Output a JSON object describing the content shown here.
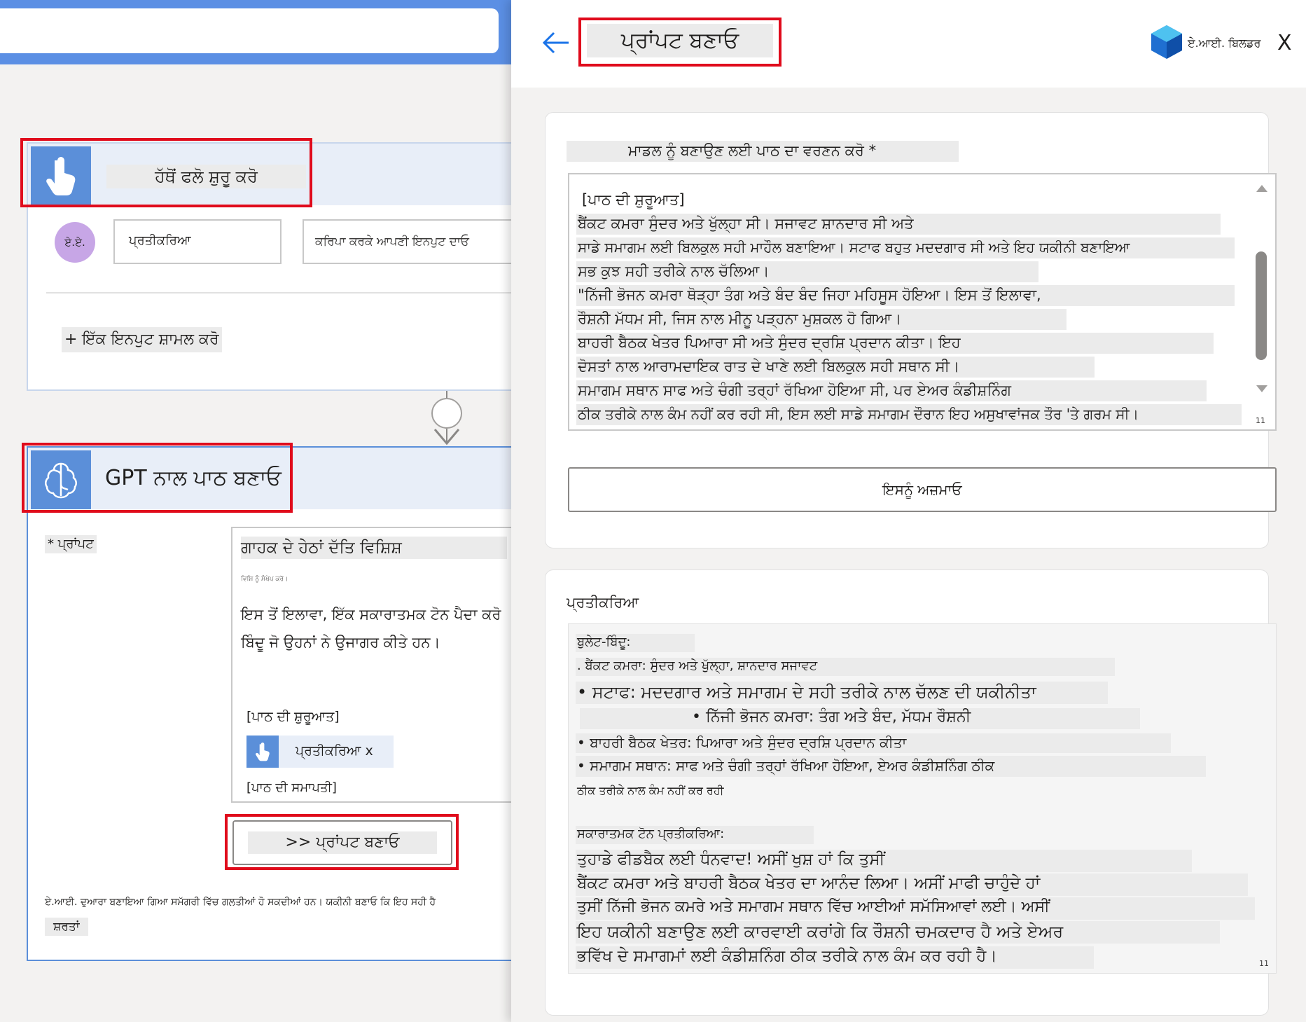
{
  "flow": {
    "trigger": {
      "title": "ਹੱਥੋਂ ਫਲੋ ਸ਼ੁਰੂ ਕਰੋ",
      "avatar": "ਏ.ਏ.",
      "input_name": "ਪ੍ਰਤੀਕਰਿਆ",
      "input_placeholder": "ਕਰਿਪਾ ਕਰਕੇ ਆਪਣੀ ਇਨਪੁਟ ਦਾਓ",
      "add_input": "+ ਇੱਕ ਇਨਪੁਟ ਸ਼ਾਮਲ ਕਰੋ"
    },
    "connector_plus": "+",
    "gpt": {
      "title": "GPT ਨਾਲ ਪਾਠ ਬਣਾਓ",
      "prompt_label": "* ਪ੍ਰਾਂਪਟ",
      "prompt_line1": "ਗਾਹਕ ਦੇ ਹੇਠਾਂ ਦੱਤਿ ਵਿਸ਼ਿਸ਼",
      "prompt_hint": "ਵਿਸ਼ਿ ਨੂੰ ਸੰਖੇਪ ਕਰੋ।",
      "prompt_line2": "ਇਸ ਤੋਂ ਇਲਾਵਾ, ਇੱਕ ਸਕਾਰਾਤਮਕ ਟੋਨ ਪੈਦਾ ਕਰੋ",
      "prompt_line3": "ਬਿੰਦੂ ਜੋ ਉਹਨਾਂ ਨੇ ਉਜਾਗਰ ਕੀਤੇ ਹਨ।",
      "text_start": "[ਪਾਠ ਦੀ ਸ਼ੁਰੂਆਤ]",
      "token": "ਪ੍ਰਤੀਕਰਿਆ x",
      "text_end": "[ਪਾਠ ਦੀ ਸਮਾਪਤੀ]",
      "create_button": ">> ਪ੍ਰਾਂਪਟ ਬਣਾਓ",
      "disclaimer": "ਏ.ਆਈ. ਦੁਆਰਾ ਬਣਾਇਆ ਗਿਆ ਸਮੱਗਰੀ ਵਿੱਚ ਗਲਤੀਆਂ ਹੋ ਸਕਦੀਆਂ ਹਨ। ਯਕੀਨੀ ਬਣਾਓ ਕਿ ਇਹ ਸਹੀ ਹੈ",
      "terms": "ਸ਼ਰਤਾਂ"
    }
  },
  "panel": {
    "title": "ਪ੍ਰਾਂਪਟ ਬਣਾਓ",
    "brand": "ਏ.ਆਈ. ਬਿਲਡਰ",
    "close": "X",
    "describe_label": "ਮਾਡਲ ਨੂੰ ਬਣਾਉਣ ਲਈ ਪਾਠ ਦਾ ਵਰਣਨ ਕਰੋ *",
    "input_lines": [
      "[ਪਾਠ ਦੀ ਸ਼ੁਰੂਆਤ]",
      "ਬੈਂਕਟ ਕਮਰਾ ਸੁੰਦਰ ਅਤੇ ਖੁੱਲ੍ਹਾ ਸੀ। ਸਜਾਵਟ ਸ਼ਾਨਦਾਰ ਸੀ ਅਤੇ",
      "ਸਾਡੇ ਸਮਾਗਮ ਲਈ ਬਿਲਕੁਲ ਸਹੀ ਮਾਹੌਲ ਬਣਾਇਆ। ਸਟਾਫ ਬਹੁਤ ਮਦਦਗਾਰ ਸੀ ਅਤੇ ਇਹ ਯਕੀਨੀ ਬਣਾਇਆ",
      "ਸਭ ਕੁਝ ਸਹੀ ਤਰੀਕੇ ਨਾਲ ਚੱਲਿਆ।",
      "\"ਨਿੱਜੀ ਭੋਜਨ ਕਮਰਾ ਥੋੜ੍ਹਾ ਤੰਗ ਅਤੇ ਬੰਦ ਬੰਦ ਜਿਹਾ ਮਹਿਸੂਸ ਹੋਇਆ। ਇਸ ਤੋਂ ਇਲਾਵਾ,",
      "ਰੌਸ਼ਨੀ ਮੱਧਮ ਸੀ, ਜਿਸ ਨਾਲ ਮੀਨੂ ਪੜ੍ਹਨਾ ਮੁਸ਼ਕਲ ਹੋ ਗਿਆ।",
      "ਬਾਹਰੀ ਬੈਠਕ ਖੇਤਰ ਪਿਆਰਾ ਸੀ ਅਤੇ ਸੁੰਦਰ ਦ੍ਰਸ਼ਿ ਪ੍ਰਦਾਨ ਕੀਤਾ। ਇਹ",
      "ਦੋਸਤਾਂ ਨਾਲ ਆਰਾਮਦਾਇਕ ਰਾਤ ਦੇ ਖਾਣੇ ਲਈ ਬਿਲਕੁਲ ਸਹੀ ਸਥਾਨ ਸੀ।",
      "ਸਮਾਗਮ ਸਥਾਨ ਸਾਫ ਅਤੇ ਚੰਗੀ ਤਰ੍ਹਾਂ ਰੱਖਿਆ ਹੋਇਆ ਸੀ, ਪਰ ਏਅਰ ਕੰਡੀਸ਼ਨਿੰਗ",
      "ਠੀਕ ਤਰੀਕੇ ਨਾਲ ਕੰਮ ਨਹੀਂ ਕਰ ਰਹੀ ਸੀ, ਇਸ ਲਈ ਸਾਡੇ ਸਮਾਗਮ ਦੌਰਾਨ ਇਹ ਅਸੁਖਾਵਾਂਜਕ ਤੌਰ 'ਤੇ ਗਰਮ ਸੀ।"
    ],
    "input_counter": "11",
    "try_button": "ਇਸਨੂੰ ਅਜ਼ਮਾਓ",
    "response_label": "ਪ੍ਰਤੀਕਰਿਆ",
    "response": {
      "bullets_heading": "ਬੁਲੇਟ-ਬਿੰਦੂ:",
      "bullets": [
        ". ਬੈਂਕਟ ਕਮਰਾ: ਸੁੰਦਰ ਅਤੇ ਖੁੱਲ੍ਹਾ, ਸ਼ਾਨਦਾਰ ਸਜਾਵਟ",
        "• ਸਟਾਫ: ਮਦਦਗਾਰ ਅਤੇ ਸਮਾਗਮ ਦੇ ਸਹੀ ਤਰੀਕੇ ਨਾਲ ਚੱਲਣ ਦੀ ਯਕੀਨੀਤਾ",
        "• ਨਿੱਜੀ ਭੋਜਨ ਕਮਰਾ: ਤੰਗ ਅਤੇ ਬੰਦ, ਮੱਧਮ ਰੌਸ਼ਨੀ",
        "• ਬਾਹਰੀ ਬੈਠਕ ਖੇਤਰ: ਪਿਆਰਾ ਅਤੇ ਸੁੰਦਰ ਦ੍ਰਸ਼ਿ ਪ੍ਰਦਾਨ ਕੀਤਾ",
        "• ਸਮਾਗਮ ਸਥਾਨ: ਸਾਫ ਅਤੇ ਚੰਗੀ ਤਰ੍ਹਾਂ ਰੱਖਿਆ ਹੋਇਆ, ਏਅਰ ਕੰਡੀਸ਼ਨਿੰਗ ਠੀਕ",
        "ਠੀਕ ਤਰੀਕੇ ਨਾਲ ਕੰਮ ਨਹੀਂ ਕਰ ਰਹੀ"
      ],
      "positive_heading": "ਸਕਾਰਾਤਮਕ ਟੋਨ ਪ੍ਰਤੀਕਰਿਆ:",
      "positive": [
        "ਤੁਹਾਡੇ ਫੀਡਬੈਕ ਲਈ ਧੰਨਵਾਦ! ਅਸੀਂ ਖੁਸ਼ ਹਾਂ ਕਿ ਤੁਸੀਂ",
        "ਬੈਂਕਟ ਕਮਰਾ ਅਤੇ ਬਾਹਰੀ ਬੈਠਕ ਖੇਤਰ ਦਾ ਆਨੰਦ ਲਿਆ। ਅਸੀਂ ਮਾਫੀ ਚਾਹੁੰਦੇ ਹਾਂ",
        "ਤੁਸੀਂ ਨਿੱਜੀ ਭੋਜਨ ਕਮਰੇ ਅਤੇ ਸਮਾਗਮ ਸਥਾਨ ਵਿੱਚ ਆਈਆਂ ਸਮੱਸਿਆਵਾਂ ਲਈ। ਅਸੀਂ",
        "ਇਹ ਯਕੀਨੀ ਬਣਾਉਣ ਲਈ ਕਾਰਵਾਈ ਕਰਾਂਗੇ ਕਿ ਰੌਸ਼ਨੀ ਚਮਕਦਾਰ ਹੈ ਅਤੇ ਏਅਰ",
        "ਭਵਿੱਖ ਦੇ ਸਮਾਗਮਾਂ ਲਈ ਕੰਡੀਸ਼ਨਿੰਗ ਠੀਕ ਤਰੀਕੇ ਨਾਲ ਕੰਮ ਕਰ ਰਹੀ ਹੈ।"
      ],
      "counter": "11"
    }
  },
  "colors": {
    "accent_blue": "#5b8fd9",
    "highlight_red": "#e00b1c",
    "back_arrow": "#1a73e8"
  }
}
